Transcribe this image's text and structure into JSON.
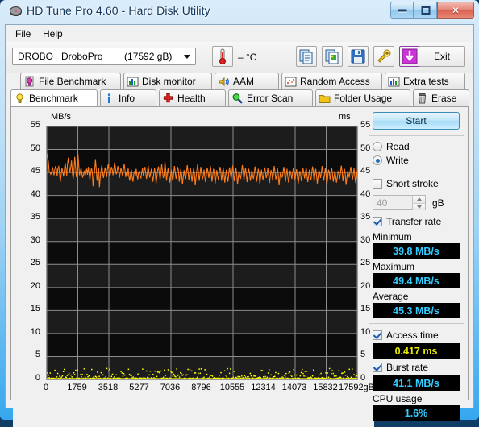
{
  "window": {
    "title": "HD Tune Pro 4.60 - Hard Disk Utility",
    "minimize": "minimize",
    "maximize": "maximize",
    "close": "close"
  },
  "menu": {
    "items": [
      "File",
      "Help"
    ]
  },
  "toolbar": {
    "drive": "DROBO   DroboPro        (17592 gB)",
    "temperature": "–  °C",
    "buttons": [
      "copy-icon",
      "screenshot-icon",
      "save-icon",
      "tools-icon",
      "download-icon"
    ],
    "exit_label": "Exit"
  },
  "tabs": {
    "row1": [
      {
        "label": "File Benchmark",
        "icon": "bulb-magenta-icon",
        "active": false
      },
      {
        "label": "Disk monitor",
        "icon": "barchart-icon",
        "active": false
      },
      {
        "label": "AAM",
        "icon": "speaker-icon",
        "active": false
      },
      {
        "label": "Random Access",
        "icon": "scatter-icon",
        "active": false
      },
      {
        "label": "Extra tests",
        "icon": "barchart-red-icon",
        "active": false
      }
    ],
    "row2": [
      {
        "label": "Benchmark",
        "icon": "bulb-yellow-icon",
        "active": true
      },
      {
        "label": "Info",
        "icon": "info-icon",
        "active": false
      },
      {
        "label": "Health",
        "icon": "redcross-icon",
        "active": false
      },
      {
        "label": "Error Scan",
        "icon": "magnifier-icon",
        "active": false
      },
      {
        "label": "Folder Usage",
        "icon": "folder-icon",
        "active": false
      },
      {
        "label": "Erase",
        "icon": "trash-icon",
        "active": false
      }
    ]
  },
  "controls": {
    "start_label": "Start",
    "mode": {
      "read_label": "Read",
      "write_label": "Write",
      "selected": "Write"
    },
    "short_stroke": {
      "label": "Short stroke",
      "checked": false,
      "value": "40",
      "unit": "gB"
    },
    "transfer_rate": {
      "label": "Transfer rate",
      "checked": true
    },
    "access_time": {
      "label": "Access time",
      "checked": true
    },
    "burst_rate": {
      "label": "Burst rate",
      "checked": true
    },
    "cpu_usage_label": "CPU usage"
  },
  "results": {
    "minimum_label": "Minimum",
    "minimum_value": "39.8 MB/s",
    "maximum_label": "Maximum",
    "maximum_value": "49.4 MB/s",
    "average_label": "Average",
    "average_value": "45.3 MB/s",
    "access_time_value": "0.417 ms",
    "burst_rate_value": "41.1 MB/s",
    "cpu_usage_value": "1.6%"
  },
  "chart_data": {
    "type": "line",
    "title": "",
    "ylabel": "MB/s",
    "ylabel_right": "ms",
    "xlabel": "gB",
    "ylim": [
      0,
      55
    ],
    "ylim_right": [
      0,
      55
    ],
    "xlim": [
      0,
      17592
    ],
    "grid": true,
    "yticks": [
      0,
      5,
      10,
      15,
      20,
      25,
      30,
      35,
      40,
      45,
      50,
      55
    ],
    "yticks_right": [
      0,
      5,
      10,
      15,
      20,
      25,
      30,
      35,
      40,
      45,
      50,
      55
    ],
    "xticks": [
      0,
      1759,
      3518,
      5277,
      7036,
      8796,
      10555,
      12314,
      14073,
      15832,
      17592
    ],
    "xtick_labels": [
      "0",
      "1759",
      "3518",
      "5277",
      "7036",
      "8796",
      "10555",
      "12314",
      "14073",
      "15832",
      "17592gB"
    ],
    "series": [
      {
        "name": "Transfer rate",
        "color": "#ff7d1a",
        "axis": "left",
        "unit": "MB/s",
        "values": [
          49.2,
          48.4,
          47.3,
          45.2,
          45.1,
          44.6,
          45.0,
          46.2,
          45.4,
          44.4,
          45.6,
          46.4,
          45.8,
          44.2,
          45.9,
          46.3,
          44.8,
          43.0,
          44.5,
          46.0,
          45.3,
          44.1,
          45.5,
          47.1,
          45.9,
          44.3,
          46.8,
          48.2,
          46.4,
          44.9,
          46.1,
          47.6,
          45.2,
          43.6,
          45.0,
          48.4,
          46.5,
          44.0,
          45.2,
          49.1,
          46.8,
          44.4,
          45.1,
          46.0,
          44.7,
          43.9,
          44.6,
          45.4,
          44.2,
          45.0,
          45.8,
          44.5,
          46.2,
          44.9,
          43.4,
          44.8,
          46.0,
          45.1,
          42.0,
          44.2,
          45.5,
          47.9,
          45.6,
          43.2,
          44.7,
          45.9,
          41.8,
          43.9,
          45.4,
          46.6,
          45.0,
          43.8,
          44.9,
          46.1,
          45.2,
          44.0,
          45.7,
          46.8,
          45.3,
          44.1,
          45.0,
          46.2,
          45.6,
          44.4,
          45.8,
          47.2,
          46.0,
          44.6,
          45.1,
          46.4,
          45.5,
          43.8,
          44.9,
          46.0,
          45.2,
          44.2,
          45.6,
          46.9,
          45.4,
          44.0,
          45.2,
          44.3,
          45.9,
          44.1,
          43.2,
          44.8,
          45.6,
          44.0,
          43.0,
          44.6,
          45.3,
          44.2,
          45.8,
          44.4,
          43.5,
          44.9,
          45.2,
          44.0,
          43.8,
          45.1,
          45.9,
          44.3,
          45.4,
          46.2,
          44.8,
          43.6,
          45.0,
          46.5,
          45.1,
          43.9,
          44.7,
          45.8,
          44.2,
          43.0,
          44.6,
          45.9,
          44.8,
          42.6,
          44.1,
          45.5,
          46.3,
          44.9,
          43.4,
          45.0,
          46.8,
          45.2,
          43.8,
          44.5,
          47.4,
          45.6,
          43.2,
          44.8,
          46.0,
          44.4,
          42.8,
          44.2,
          45.6,
          44.0,
          43.1,
          44.9,
          46.4,
          45.0,
          43.6,
          44.8,
          46.2,
          45.4,
          43.0,
          44.4,
          45.8,
          44.6,
          42.4,
          44.0,
          45.5,
          44.2,
          43.6,
          45.0,
          46.6,
          45.2,
          43.4,
          44.8,
          46.0,
          44.5,
          43.0,
          44.6,
          45.9,
          44.8,
          42.2,
          43.9,
          45.4,
          46.8,
          45.0,
          43.2,
          44.6,
          46.2,
          44.9,
          43.5,
          44.2,
          45.6,
          44.0,
          42.9,
          44.5,
          46.0,
          45.2,
          43.8,
          44.9,
          46.4,
          45.0,
          43.0,
          44.4,
          45.8,
          44.6,
          42.6,
          44.0,
          45.5,
          44.3,
          43.4,
          44.8,
          46.2,
          45.4,
          43.2,
          44.6,
          46.0,
          44.8,
          42.8,
          44.2,
          45.6,
          44.1,
          43.0,
          44.7,
          46.1,
          45.0,
          43.6,
          44.9,
          46.5,
          45.2,
          43.1,
          44.4,
          45.9,
          44.6,
          42.4,
          44.0,
          45.4,
          44.2,
          43.8,
          45.1,
          46.6,
          45.3,
          43.4,
          44.8,
          46.0,
          44.5,
          42.9,
          44.6,
          45.8,
          44.9,
          43.2,
          44.1,
          45.5,
          44.3,
          43.6,
          44.9,
          46.3,
          45.1,
          43.0,
          44.4,
          45.8,
          44.7,
          42.5,
          44.0,
          45.6,
          44.2,
          43.4,
          44.8,
          46.1,
          45.2,
          43.8,
          44.6,
          46.0,
          44.4,
          42.7,
          44.1,
          45.5,
          44.9,
          43.2,
          44.8,
          46.4,
          45.0,
          43.5,
          44.2,
          45.9,
          44.6,
          42.2,
          43.8,
          45.2,
          44.4,
          43.9,
          45.0,
          46.2,
          44.8,
          43.0,
          44.5,
          45.8,
          44.1,
          42.8,
          44.0,
          45.4,
          44.7,
          43.6,
          44.9,
          46.0,
          45.1,
          43.3,
          44.6,
          45.7,
          44.2,
          42.5,
          43.9,
          45.3,
          44.8,
          43.1,
          44.4,
          45.9,
          45.0,
          43.7,
          44.8,
          46.1,
          44.5,
          42.9,
          44.2,
          45.6,
          44.0,
          43.4,
          44.9,
          46.3,
          45.2,
          43.0,
          44.6,
          45.8,
          44.4,
          42.6,
          44.1,
          45.5,
          44.9,
          43.8,
          45.0,
          46.4,
          44.7,
          43.2,
          44.5,
          45.9,
          44.3,
          42.4,
          44.0,
          45.6,
          45.1,
          43.5,
          44.8,
          46.0,
          44.6,
          43.0,
          44.2,
          45.4,
          44.1,
          42.8,
          43.9,
          45.2,
          44.9,
          43.6,
          45.0,
          46.5,
          45.3,
          43.1,
          44.4,
          45.8,
          44.5,
          42.3,
          43.8,
          45.1,
          44.7,
          43.9,
          45.2,
          46.2,
          44.8,
          43.4,
          44.6,
          45.9,
          44.2,
          42.7,
          44.0,
          45.5
        ]
      },
      {
        "name": "Access time",
        "color": "#ffff00",
        "axis": "right",
        "unit": "ms",
        "style": "dots",
        "mean": 0.417,
        "range": [
          0.2,
          2.4
        ]
      }
    ]
  }
}
